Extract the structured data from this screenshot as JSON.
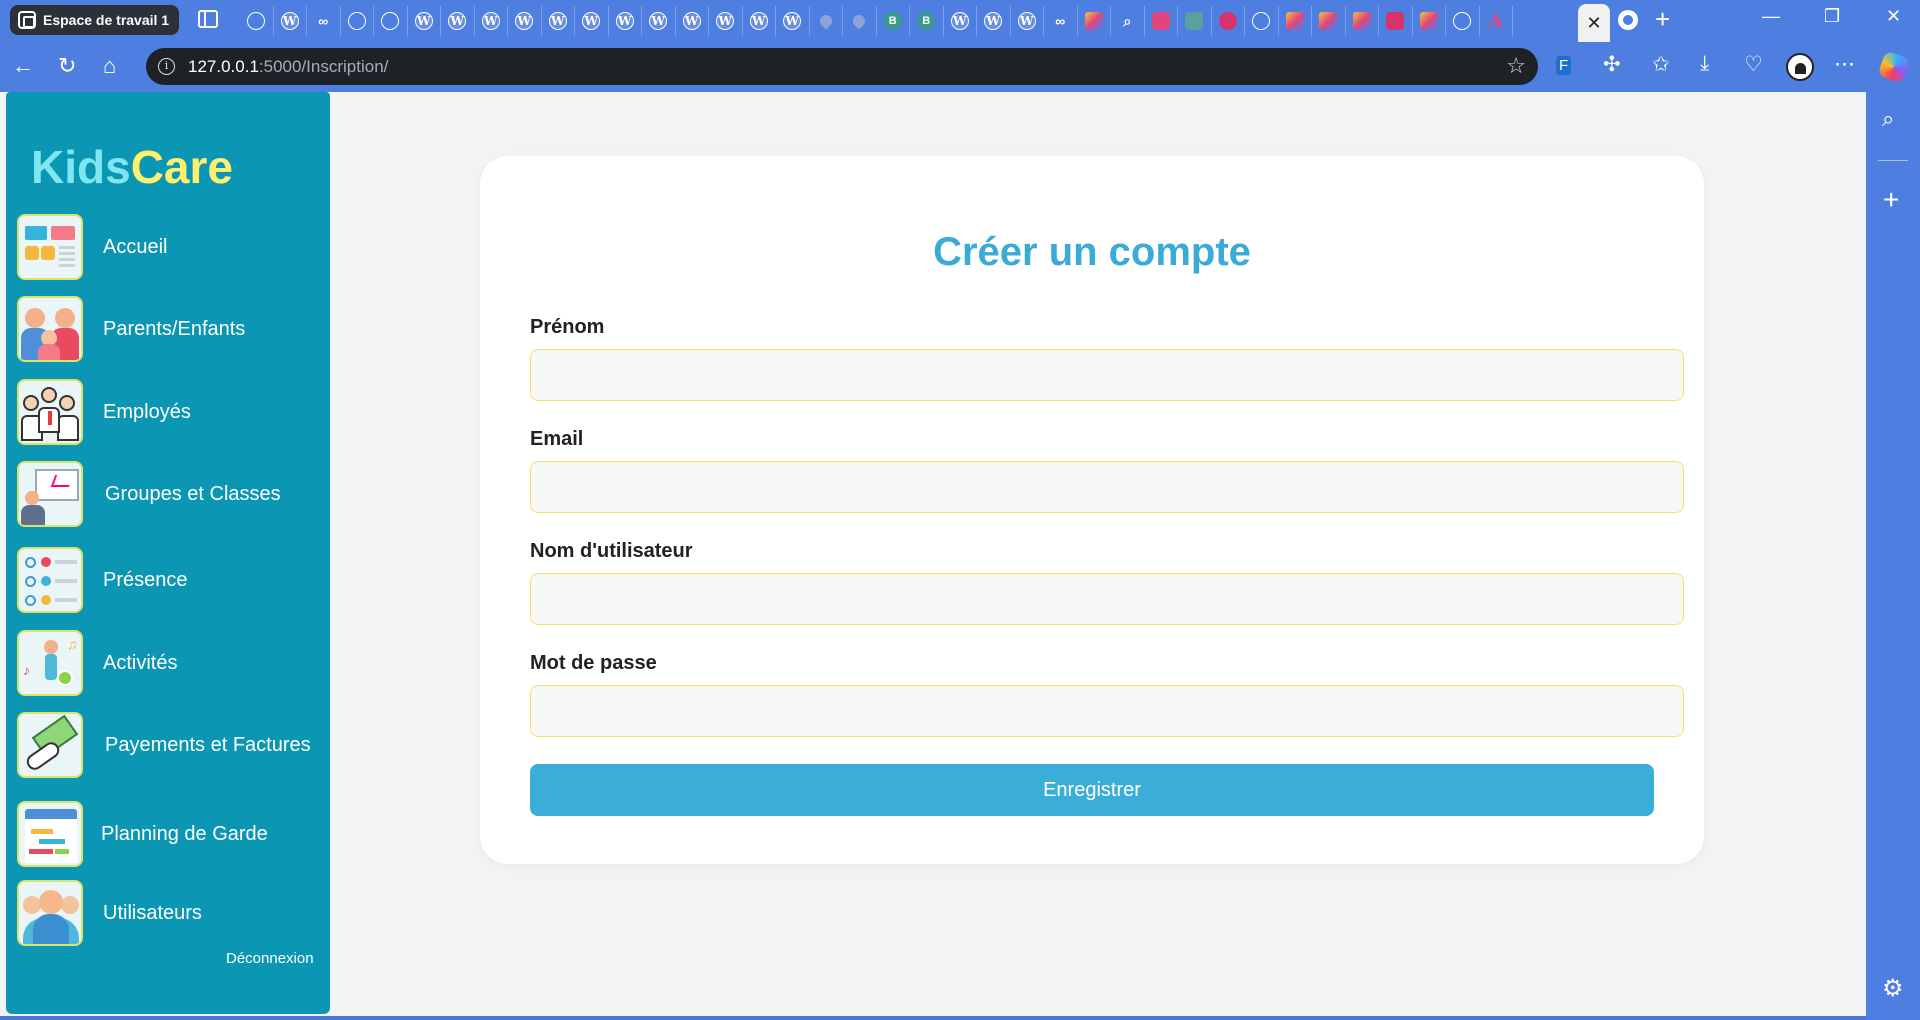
{
  "browser": {
    "workspace_label": "Espace de travail 1",
    "url_host": "127.0.0.1",
    "url_rest": ":5000/Inscription/",
    "tab_favicons": [
      "globe",
      "wp",
      "inf",
      "globe",
      "globe",
      "wp",
      "wp",
      "wp",
      "wp",
      "wp",
      "wp",
      "wp",
      "wp",
      "wp",
      "wp",
      "wp",
      "wp",
      "drop",
      "drop",
      "b",
      "b",
      "wp",
      "wp",
      "wp",
      "inf",
      "multi",
      "search",
      "pin-red",
      "green",
      "pin",
      "globe",
      "multi",
      "multi",
      "multi",
      "yt",
      "multi",
      "globe",
      "a"
    ]
  },
  "sidebar": {
    "brand_kids": "Kids",
    "brand_care": "Care",
    "items": [
      {
        "label": "Accueil",
        "icon": "dashboard-icon"
      },
      {
        "label": "Parents/Enfants",
        "icon": "family-icon"
      },
      {
        "label": "Employés",
        "icon": "employees-icon"
      },
      {
        "label": "Groupes et Classes",
        "icon": "classroom-icon"
      },
      {
        "label": "Présence",
        "icon": "attendance-checklist-icon"
      },
      {
        "label": "Activités",
        "icon": "activities-icon"
      },
      {
        "label": "Payements et Factures",
        "icon": "payment-hand-money-icon"
      },
      {
        "label": "Planning de Garde",
        "icon": "calendar-planning-icon"
      },
      {
        "label": "Utilisateurs",
        "icon": "users-group-icon"
      }
    ],
    "logout_label": "Déconnexion"
  },
  "form": {
    "title": "Créer un compte",
    "fields": [
      {
        "label": "Prénom",
        "value": "",
        "placeholder": ""
      },
      {
        "label": "Email",
        "value": "",
        "placeholder": ""
      },
      {
        "label": "Nom d'utilisateur",
        "value": "",
        "placeholder": ""
      },
      {
        "label": "Mot de passe",
        "value": "",
        "placeholder": ""
      }
    ],
    "submit_label": "Enregistrer"
  },
  "colors": {
    "sidebar_bg": "#0b97b4",
    "brand_kids": "#7ee6f0",
    "brand_care": "#ffef6e",
    "title": "#3aaad6",
    "button": "#3aaed9",
    "input_border": "#f4e36b"
  }
}
